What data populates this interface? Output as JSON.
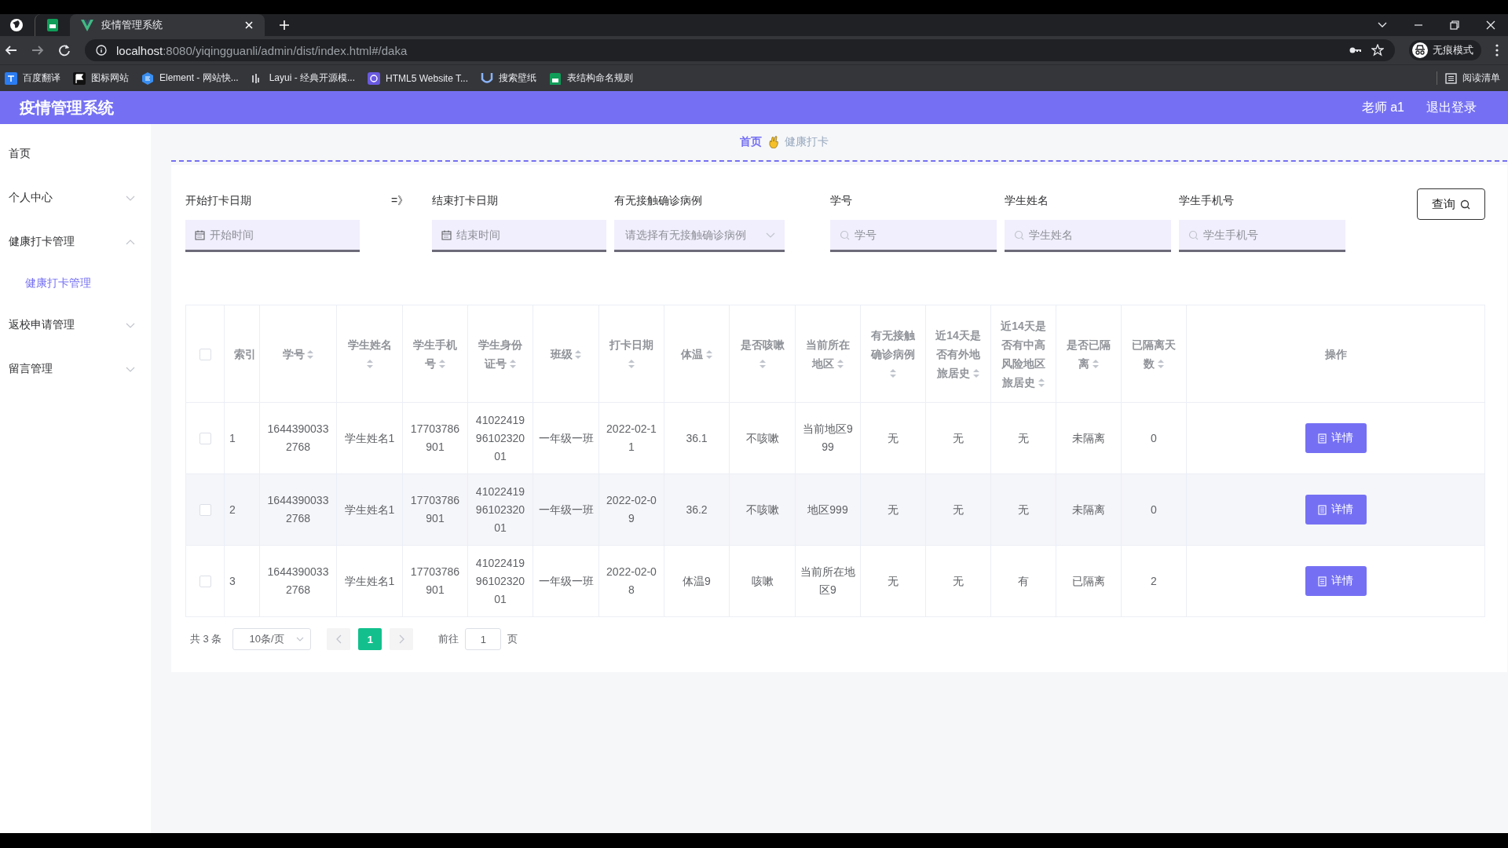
{
  "browser": {
    "tabs": [
      {
        "kind": "pinned",
        "selected": false
      },
      {
        "kind": "page",
        "title": "疫情管理系统",
        "selected": true
      }
    ],
    "url_host": "localhost",
    "url_rest": ":8080/yiqingguanli/admin/dist/index.html#/daka",
    "incognito_label": "无痕模式",
    "bookmarks": [
      {
        "label": "百度翻译"
      },
      {
        "label": "图标网站"
      },
      {
        "label": "Element - 网站快..."
      },
      {
        "label": "Layui - 经典开源模..."
      },
      {
        "label": "HTML5 Website T..."
      },
      {
        "label": "搜索壁纸"
      },
      {
        "label": "表结构命名规则"
      }
    ],
    "reading_list": "阅读清单"
  },
  "app": {
    "title": "疫情管理系统",
    "user": "老师 a1",
    "logout": "退出登录"
  },
  "sidebar": {
    "items": [
      {
        "label": "首页",
        "kind": "link"
      },
      {
        "label": "个人中心",
        "kind": "submenu",
        "expanded": false
      },
      {
        "label": "健康打卡管理",
        "kind": "submenu",
        "expanded": true,
        "children": [
          {
            "label": "健康打卡管理",
            "selected": true
          }
        ]
      },
      {
        "label": "返校申请管理",
        "kind": "submenu",
        "expanded": false
      },
      {
        "label": "留言管理",
        "kind": "submenu",
        "expanded": false
      }
    ]
  },
  "breadcrumb": [
    {
      "label": "首页",
      "current": false
    },
    {
      "label": "健康打卡",
      "current": true
    }
  ],
  "filters": [
    {
      "kind": "date",
      "label": "开始打卡日期",
      "placeholder": "开始时间"
    },
    {
      "kind": "separator",
      "text": "=》"
    },
    {
      "kind": "date",
      "label": "结束打卡日期",
      "placeholder": "结束时间"
    },
    {
      "kind": "select",
      "label": "有无接触确诊病例",
      "placeholder": "请选择有无接触确诊病例"
    },
    {
      "kind": "search",
      "label": "学号",
      "placeholder": "学号"
    },
    {
      "kind": "search",
      "label": "学生姓名",
      "placeholder": "学生姓名"
    },
    {
      "kind": "search",
      "label": "学生手机号",
      "placeholder": "学生手机号"
    }
  ],
  "query_button": "查询",
  "table": {
    "all_selected": false,
    "columns": [
      {
        "label": "索引",
        "sortable": false
      },
      {
        "label": "学号",
        "sortable": true
      },
      {
        "label": "学生姓名",
        "sortable": true
      },
      {
        "label": "学生手机号",
        "sortable": true
      },
      {
        "label": "学生身份证号",
        "sortable": true
      },
      {
        "label": "班级",
        "sortable": true
      },
      {
        "label": "打卡日期",
        "sortable": true
      },
      {
        "label": "体温",
        "sortable": true
      },
      {
        "label": "是否咳嗽",
        "sortable": true
      },
      {
        "label": "当前所在地区",
        "sortable": true
      },
      {
        "label": "有无接触确诊病例",
        "sortable": true
      },
      {
        "label": "近14天是否有外地旅居史",
        "sortable": true
      },
      {
        "label": "近14天是否有中高风险地区旅居史",
        "sortable": true
      },
      {
        "label": "是否已隔离",
        "sortable": true
      },
      {
        "label": "已隔离天数",
        "sortable": true
      },
      {
        "label": "操作",
        "sortable": false
      }
    ],
    "rows": [
      {
        "selected": false,
        "cells": [
          "1",
          "16443900332768",
          "学生姓名1",
          "17703786901",
          "410224199610232001",
          "一年级一班",
          "2022-02-11",
          "36.1",
          "不咳嗽",
          "当前地区999",
          "无",
          "无",
          "无",
          "未隔离",
          "0"
        ],
        "action": "详情"
      },
      {
        "selected": false,
        "cells": [
          "2",
          "16443900332768",
          "学生姓名1",
          "17703786901",
          "410224199610232001",
          "一年级一班",
          "2022-02-09",
          "36.2",
          "不咳嗽",
          "地区999",
          "无",
          "无",
          "无",
          "未隔离",
          "0"
        ],
        "action": "详情"
      },
      {
        "selected": false,
        "cells": [
          "3",
          "16443900332768",
          "学生姓名1",
          "17703786901",
          "410224199610232001",
          "一年级一班",
          "2022-02-08",
          "体温9",
          "咳嗽",
          "当前所在地区9",
          "无",
          "无",
          "有",
          "已隔离",
          "2"
        ],
        "action": "详情"
      }
    ]
  },
  "pagination": {
    "total": "共 3 条",
    "page_size": "10条/页",
    "pages": [
      {
        "label": "1",
        "selected": true
      }
    ],
    "goto_label": "前往",
    "goto_value": "1",
    "goto_suffix": "页"
  }
}
